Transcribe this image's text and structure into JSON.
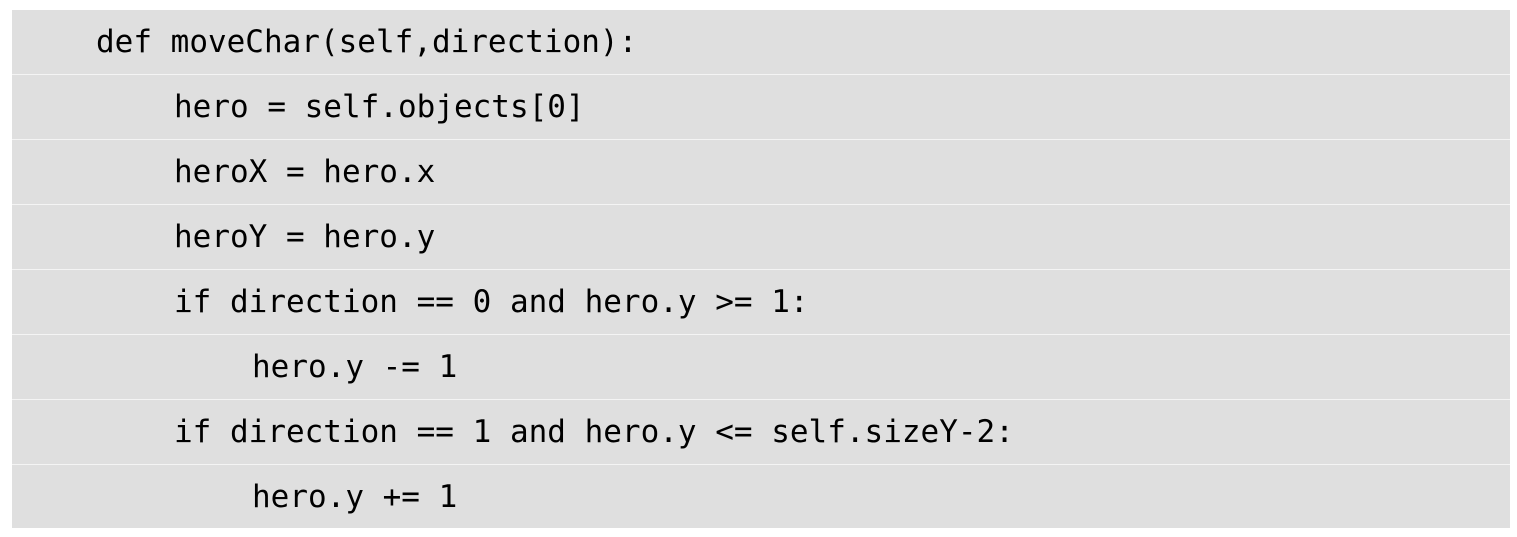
{
  "code": {
    "lines": [
      "def moveChar(self,direction):",
      "hero = self.objects[0]",
      "heroX = hero.x",
      "heroY = hero.y",
      "if direction == 0 and hero.y >= 1:",
      "hero.y -= 1",
      "if direction == 1 and hero.y <= self.sizeY-2:",
      "hero.y += 1"
    ]
  }
}
